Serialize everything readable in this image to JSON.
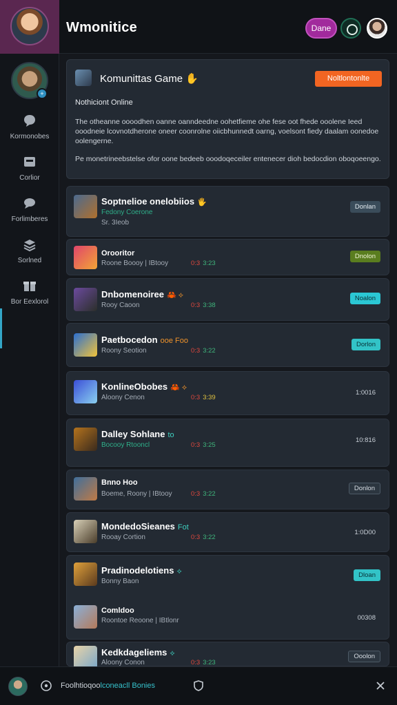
{
  "app": {
    "title": "Wmonitice"
  },
  "header": {
    "done_label": "Dane"
  },
  "sidebar": {
    "items": [
      {
        "label": "Kormonobes",
        "icon": "chat-bubble-icon"
      },
      {
        "label": "Corlior",
        "icon": "inbox-icon"
      },
      {
        "label": "Forlimberes",
        "icon": "speech-icon"
      },
      {
        "label": "Sorlned",
        "icon": "stack-icon"
      },
      {
        "label": "Bor Eexlorol",
        "icon": "gift-icon"
      }
    ]
  },
  "notice": {
    "title": "Komunittas Game",
    "title_icon": "✋",
    "cta": "Noltlontonlte",
    "subtitle": "Nothiciont Online",
    "paragraph1": "The otheanne oooodhen oanne oanndeedne oohetfieme ohe fese oot fhede ooolene Ieed ooodneie lcovnotdherone oneer coonrolne oiicbhunnedt oarng, voelsont fiedy daalam oonedoe oolengerne.",
    "paragraph2": "Pe monetrineebstelse ofor oone bedeeb ooodoqeceiler entenecer dioh bedocdion oboqoeengo."
  },
  "games": [
    {
      "title": "Soptnelioe onelobiios",
      "accent": "🖐",
      "subtitle": "Fedony Coerone",
      "stats_a": "Sr. 3Ieob",
      "stats_b": "",
      "button": "Donlan"
    },
    {
      "title": "Orooritor",
      "accent": "",
      "subtitle": "Roone Boooy | IBtooy",
      "stats_a": "0:3",
      "stats_b": "3:23",
      "button": "Dnolon"
    },
    {
      "title": "Dnbomenoiree",
      "accent": "🦀 ⟡",
      "subtitle": "Rooy Caoon",
      "stats_a": "0:3",
      "stats_b": "3:38",
      "button": "Noalon"
    },
    {
      "title": "Paetbocedon",
      "accent": "ooe Foo",
      "subtitle": "Roony Seotion",
      "stats_a": "0:3",
      "stats_b": "3:22",
      "button": "Dorlon"
    },
    {
      "title": "KonlineObobes",
      "accent": "🦀 ⟡",
      "subtitle": "Aloony Cenon",
      "stats_a": "0:3",
      "stats_b": "3:39",
      "button": "1:0016"
    },
    {
      "title": "Dalley Sohlane",
      "accent": "to",
      "subtitle": "Bocooy Rtooncl",
      "stats_a": "0:3",
      "stats_b": "3:25",
      "button": "10:816"
    },
    {
      "title": "Bnno Hoo",
      "accent": "",
      "subtitle": "Boeme, Roony | IBtooy",
      "stats_a": "0:3",
      "stats_b": "3:22",
      "button": "Donlon"
    },
    {
      "title": "MondedoSieanes",
      "accent": "Fot",
      "subtitle": "Rooay Cortion",
      "stats_a": "0:3",
      "stats_b": "3:22",
      "button": "1:0D00"
    },
    {
      "title": "Pradinodelotiens",
      "accent": "⟡",
      "subtitle": "Bonny Baon",
      "stats_a": "",
      "stats_b": "",
      "button": "Dloan"
    },
    {
      "title": "Comldoo",
      "accent": "",
      "subtitle": "Roontoe Reoone | IBtlonr",
      "stats_a": "",
      "stats_b": "",
      "button": "00308"
    },
    {
      "title": "Kedkdageliems",
      "accent": "⟡",
      "subtitle": "Aloony Conon",
      "stats_a": "0:3",
      "stats_b": "3:23",
      "button": "Ooolon"
    }
  ],
  "bottombar": {
    "status_prefix": "Foolhtioqoo",
    "status_highlight": "lconeacll Bonies"
  }
}
